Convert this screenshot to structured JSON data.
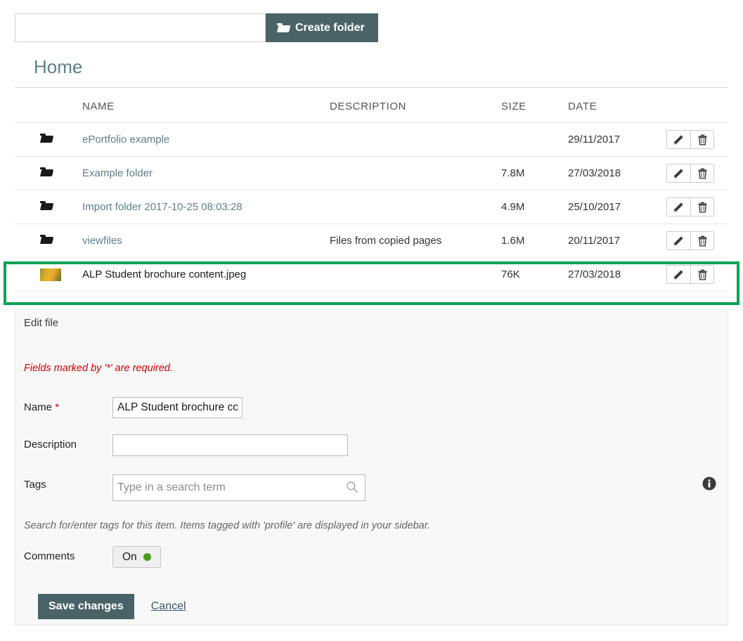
{
  "createbar": {
    "input_value": "",
    "input_placeholder": "",
    "button_label": "Create folder"
  },
  "breadcrumb": {
    "title": "Home"
  },
  "filetable": {
    "columns": {
      "icon": "",
      "name": "NAME",
      "description": "DESCRIPTION",
      "size": "SIZE",
      "date": "DATE",
      "actions": ""
    },
    "rows": [
      {
        "icon": "folder-icon",
        "name": "ePortfolio example",
        "description": "",
        "size": "",
        "date": "29/11/2017",
        "is_link": true,
        "highlighted": false
      },
      {
        "icon": "folder-icon",
        "name": "Example folder",
        "description": "",
        "size": "7.8M",
        "date": "27/03/2018",
        "is_link": true,
        "highlighted": false
      },
      {
        "icon": "folder-icon",
        "name": "Import folder 2017-10-25 08:03:28",
        "description": "",
        "size": "4.9M",
        "date": "25/10/2017",
        "is_link": true,
        "highlighted": false
      },
      {
        "icon": "folder-icon",
        "name": "viewfiles",
        "description": "Files from copied pages",
        "size": "1.6M",
        "date": "20/11/2017",
        "is_link": true,
        "highlighted": false
      },
      {
        "icon": "image-thumbnail",
        "name": "ALP Student brochure content.jpeg",
        "description": "",
        "size": "76K",
        "date": "27/03/2018",
        "is_link": false,
        "highlighted": true
      }
    ],
    "row_actions": {
      "edit": "edit-pencil-icon",
      "delete": "trash-icon"
    }
  },
  "editform": {
    "legend": "Edit file",
    "required_note": "Fields marked by '*' are required.",
    "name_label": "Name",
    "name_required_mark": "*",
    "name_value": "ALP Student brochure content.jpeg",
    "description_label": "Description",
    "description_value": "",
    "tags_label": "Tags",
    "tags_value": "",
    "tags_placeholder": "Type in a search term",
    "tags_help": "Search for/enter tags for this item. Items tagged with 'profile' are displayed in your sidebar.",
    "comments_label": "Comments",
    "comments_toggle_state": "On",
    "save_label": "Save changes",
    "cancel_label": "Cancel"
  },
  "colors": {
    "brand_dark": "#4a6368",
    "link_slate": "#5c7f8e",
    "highlight_green": "#0aa355",
    "required_red": "#d00000",
    "toggle_green": "#4c9a1e",
    "panel_bg": "#f8f8f8"
  }
}
